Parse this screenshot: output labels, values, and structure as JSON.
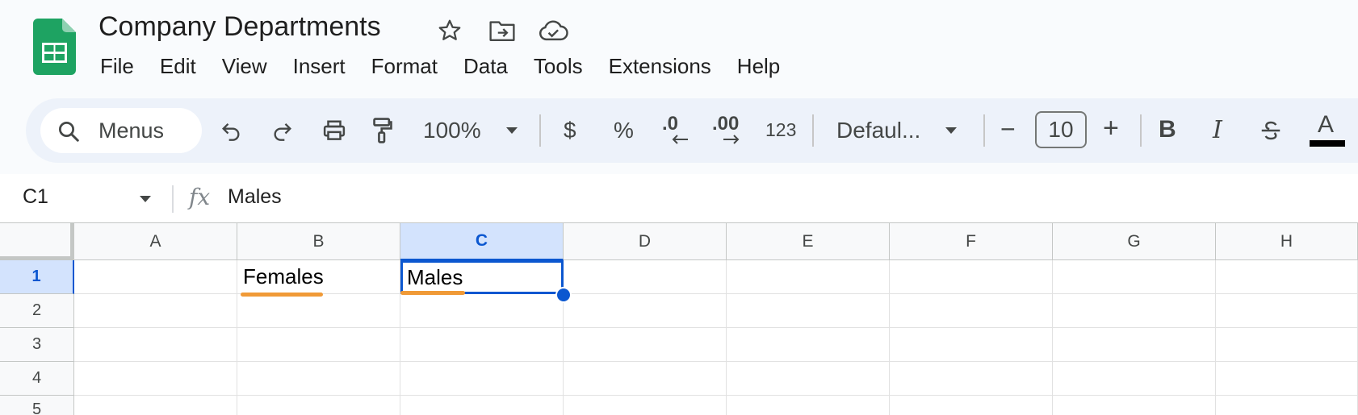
{
  "document": {
    "title": "Company Departments",
    "header_icons": [
      "star-icon",
      "move-folder-icon",
      "cloud-saved-icon"
    ]
  },
  "menu": [
    "File",
    "Edit",
    "View",
    "Insert",
    "Format",
    "Data",
    "Tools",
    "Extensions",
    "Help"
  ],
  "toolbar": {
    "search_placeholder": "Menus",
    "zoom": "100%",
    "currency": "$",
    "percent": "%",
    "decrease_decimal": ".0",
    "increase_decimal": ".00",
    "more_formats": "123",
    "font": "Defaul...",
    "font_size": "10",
    "decrease_size": "−",
    "increase_size": "+",
    "bold": "B",
    "italic": "I",
    "text_color": "A"
  },
  "formula_bar": {
    "name_box": "C1",
    "fx": "fx",
    "value": "Males"
  },
  "grid": {
    "columns": [
      "A",
      "B",
      "C",
      "D",
      "E",
      "F",
      "G",
      "H"
    ],
    "rows": [
      "1",
      "2",
      "3",
      "4",
      "5"
    ],
    "selected_column": "C",
    "selected_row": "1",
    "cells": {
      "B1": "Females",
      "C1": "Males"
    }
  },
  "colors": {
    "accent": "#0b57d0",
    "selection_header": "#d3e3fd",
    "spellcheck_underline": "#f09a37",
    "logo_green": "#1ea362"
  }
}
